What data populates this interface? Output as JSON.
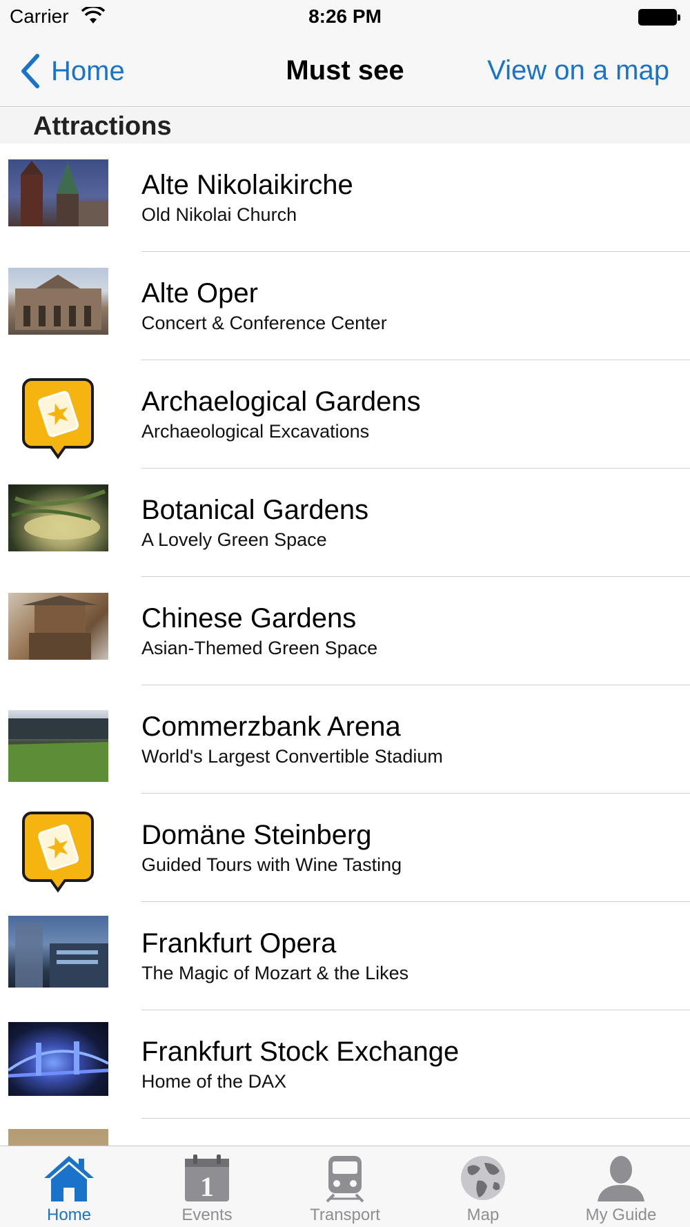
{
  "status_bar": {
    "carrier": "Carrier",
    "time": "8:26 PM"
  },
  "nav": {
    "back_label": "Home",
    "title": "Must see",
    "right_label": "View on a map",
    "accent_color": "#1a73c9"
  },
  "section": {
    "header": "Attractions"
  },
  "items": [
    {
      "title": "Alte Nikolaikirche",
      "subtitle": "Old Nikolai Church",
      "image": "photo-church"
    },
    {
      "title": "Alte Oper",
      "subtitle": "Concert & Conference Center",
      "image": "photo-opera-house"
    },
    {
      "title": "Archaelogical Gardens",
      "subtitle": "Archaeological Excavations",
      "image": "ticket-star-badge-icon"
    },
    {
      "title": "Botanical Gardens",
      "subtitle": "A Lovely Green Space",
      "image": "photo-plant"
    },
    {
      "title": "Chinese Gardens",
      "subtitle": "Asian-Themed Green Space",
      "image": "photo-pagoda"
    },
    {
      "title": "Commerzbank Arena",
      "subtitle": "World's Largest Convertible Stadium",
      "image": "photo-stadium"
    },
    {
      "title": "Domäne Steinberg",
      "subtitle": "Guided Tours with Wine Tasting",
      "image": "ticket-star-badge-icon"
    },
    {
      "title": "Frankfurt Opera",
      "subtitle": "The Magic of Mozart & the Likes",
      "image": "photo-opera-building"
    },
    {
      "title": "Frankfurt Stock Exchange",
      "subtitle": "Home of the DAX",
      "image": "photo-bridge-night"
    }
  ],
  "tab_bar": {
    "tabs": [
      {
        "label": "Home",
        "icon": "house-icon",
        "active": true
      },
      {
        "label": "Events",
        "icon": "calendar-icon",
        "active": false
      },
      {
        "label": "Transport",
        "icon": "train-icon",
        "active": false
      },
      {
        "label": "Map",
        "icon": "globe-icon",
        "active": false
      },
      {
        "label": "My Guide",
        "icon": "person-icon",
        "active": false
      }
    ],
    "active_color": "#1a73c9",
    "inactive_color": "#8e8e93"
  }
}
